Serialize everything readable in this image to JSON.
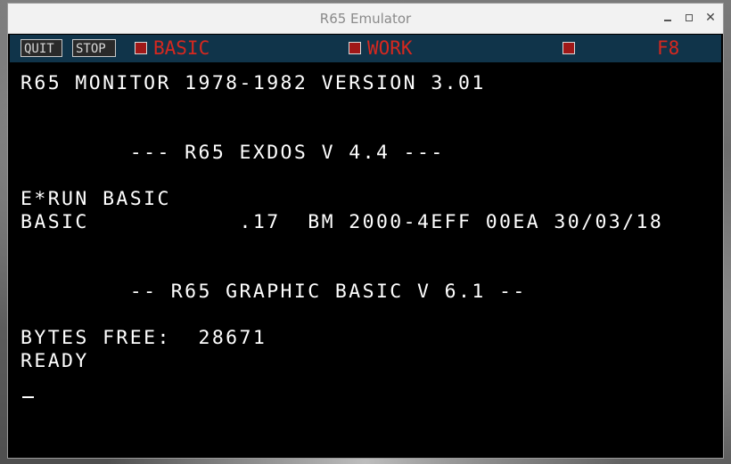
{
  "window": {
    "title": "R65 Emulator",
    "minimize_label": "",
    "maximize_label": "",
    "close_label": "✕"
  },
  "toolbar": {
    "quit_label": "QUIT",
    "stop_label": "STOP",
    "indicators": [
      {
        "label": "BASIC",
        "color": "#a01818"
      },
      {
        "label": "WORK",
        "color": "#a01818"
      },
      {
        "label": "F8",
        "color": "#a01818"
      }
    ],
    "background": "#10344a",
    "label_color": "#d6281f"
  },
  "terminal": {
    "lines": [
      "R65 MONITOR 1978-1982 VERSION 3.01",
      "        --- R65 EXDOS V 4.4 ---",
      "E*RUN BASIC",
      "BASIC           .17  BM 2000-4EFF 00EA 30/03/18",
      "        -- R65 GRAPHIC BASIC V 6.1 --",
      "BYTES FREE:  28671",
      "READY"
    ],
    "cursor": "_"
  }
}
